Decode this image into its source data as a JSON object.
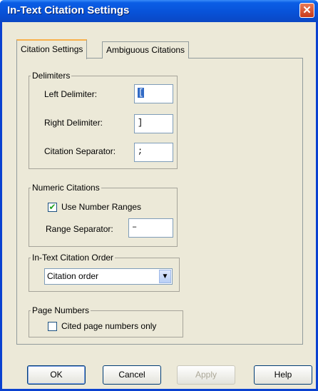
{
  "window": {
    "title": "In-Text Citation Settings"
  },
  "tabs": [
    {
      "label": "Citation Settings",
      "active": true
    },
    {
      "label": "Ambiguous Citations",
      "active": false
    }
  ],
  "delimiters": {
    "legend": "Delimiters",
    "left_label": "Left Delimiter:",
    "left_value": "[",
    "right_label": "Right Delimiter:",
    "right_value": "]",
    "separator_label": "Citation Separator:",
    "separator_value": ";"
  },
  "numeric": {
    "legend": "Numeric Citations",
    "use_ranges_label": "Use Number Ranges",
    "use_ranges_checked": true,
    "range_sep_label": "Range Separator:",
    "range_sep_value": "–"
  },
  "order": {
    "legend": "In-Text Citation Order",
    "selected": "Citation order"
  },
  "pages": {
    "legend": "Page Numbers",
    "cited_only_label": "Cited page numbers only",
    "cited_only_checked": false
  },
  "buttons": {
    "ok": "OK",
    "cancel": "Cancel",
    "apply": "Apply",
    "help": "Help"
  },
  "colors": {
    "titlebar": "#0a5ee6",
    "dialog_bg": "#ece9d8",
    "selection": "#316ac5",
    "close": "#c73a1a"
  }
}
